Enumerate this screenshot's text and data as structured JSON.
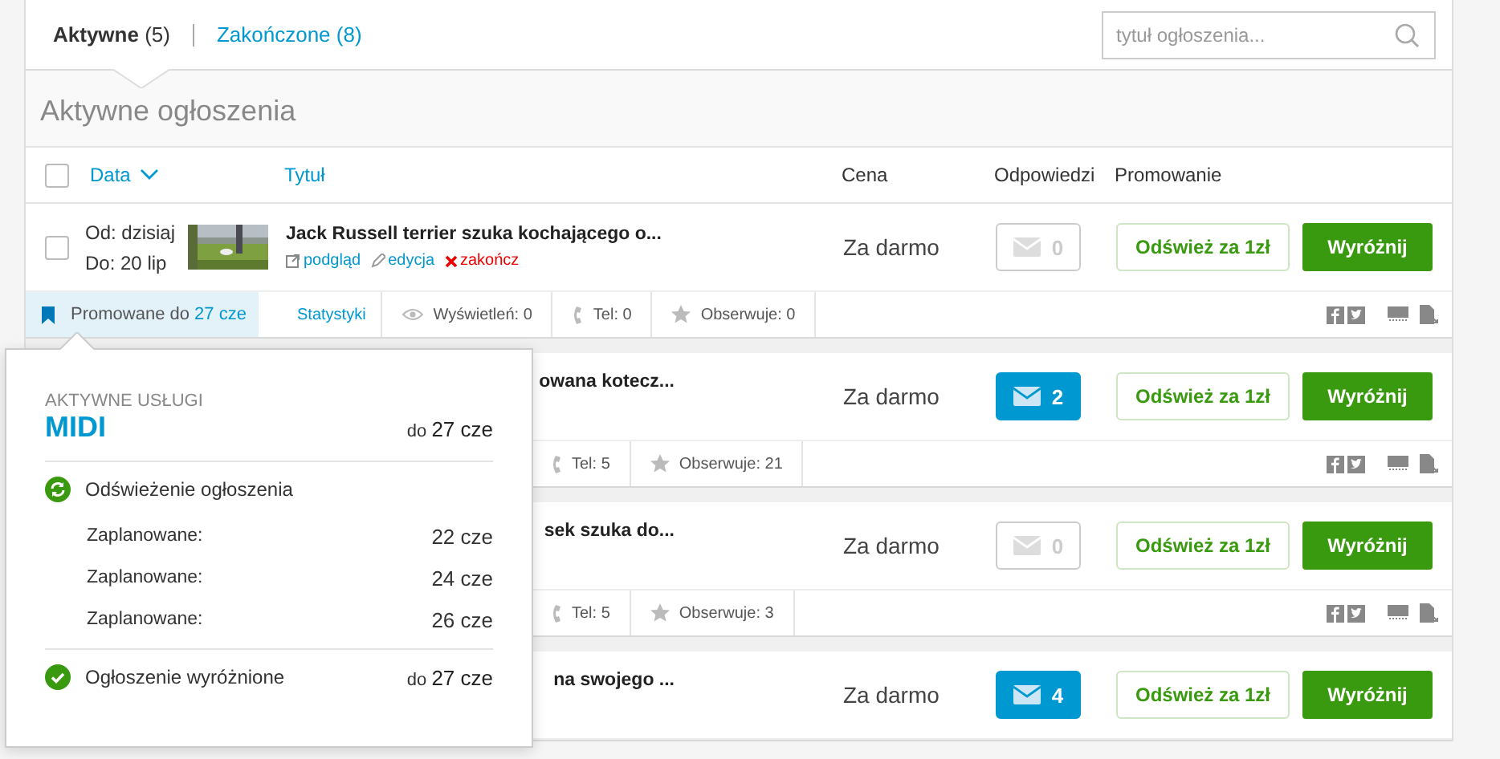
{
  "tabs": [
    {
      "label": "Aktywne",
      "count": "(5)",
      "selected": true
    },
    {
      "label": "Zakończone",
      "count": "(8)",
      "selected": false
    }
  ],
  "search": {
    "placeholder": "tytuł ogłoszenia..."
  },
  "section_title": "Aktywne ogłoszenia",
  "select_all": {
    "checked": false
  },
  "columns": [
    {
      "label": "Data",
      "sorted": true
    },
    {
      "label": "Tytuł",
      "sorted": false
    },
    {
      "label": "Cena",
      "sorted": false
    },
    {
      "label": "Odpowiedzi",
      "sorted": false
    },
    {
      "label": "Promowanie",
      "sorted": false
    }
  ],
  "rows": [
    {
      "kind": "full",
      "checked": false,
      "date_from": "Od: dzisiaj",
      "date_to": "Do: 20 lip",
      "title": "Jack Russell terrier szuka kochającego o...",
      "links": [
        {
          "kind": "preview",
          "label": "podgląd"
        },
        {
          "kind": "edit",
          "label": "edycja"
        },
        {
          "kind": "end",
          "label": "zakończ"
        }
      ],
      "price": "Za darmo",
      "replies": {
        "count": "0",
        "unread": false
      },
      "refresh": "Odśwież za 1zł",
      "feature": "Wyróżnij",
      "stats": [
        {
          "kind": "promo",
          "label": "Promowane do",
          "value": "27 cze"
        },
        {
          "kind": "link",
          "label": "Statystyki"
        },
        {
          "kind": "views",
          "label": "Wyświetleń: 0"
        },
        {
          "kind": "phone",
          "label": "Tel: 0"
        },
        {
          "kind": "watch",
          "label": "Obserwuje: 0"
        }
      ]
    },
    {
      "kind": "covered",
      "title": "owana kotecz...",
      "price": "Za darmo",
      "replies": {
        "count": "2",
        "unread": true
      },
      "refresh": "Odśwież za 1zł",
      "feature": "Wyróżnij",
      "stats": [
        {
          "kind": "phone",
          "label": "Tel: 5"
        },
        {
          "kind": "watch",
          "label": "Obserwuje: 21"
        }
      ]
    },
    {
      "kind": "covered",
      "title": "sek szuka do...",
      "price": "Za darmo",
      "replies": {
        "count": "0",
        "unread": false
      },
      "refresh": "Odśwież za 1zł",
      "feature": "Wyróżnij",
      "stats": [
        {
          "kind": "phone",
          "label": "Tel: 5"
        },
        {
          "kind": "watch",
          "label": "Obserwuje: 3"
        }
      ]
    },
    {
      "kind": "covered",
      "title": "na swojego ...",
      "price": "Za darmo",
      "replies": {
        "count": "4",
        "unread": true
      },
      "refresh": "Odśwież za 1zł",
      "feature": "Wyróżnij"
    }
  ],
  "popover": {
    "heading": "AKTYWNE USŁUGI",
    "plan": "MIDI",
    "plan_until": "do **27 cze**",
    "services": [
      {
        "kind": "refresh",
        "label": "Odświeżenie ogłoszenia",
        "schedule": [
          {
            "label": "Zaplanowane:",
            "date": "22 cze"
          },
          {
            "label": "Zaplanowane:",
            "date": "24 cze"
          },
          {
            "label": "Zaplanowane:",
            "date": "26 cze"
          }
        ]
      },
      {
        "kind": "featured",
        "label": "Ogłoszenie wyróżnione",
        "until": "do **27 cze**"
      }
    ]
  }
}
